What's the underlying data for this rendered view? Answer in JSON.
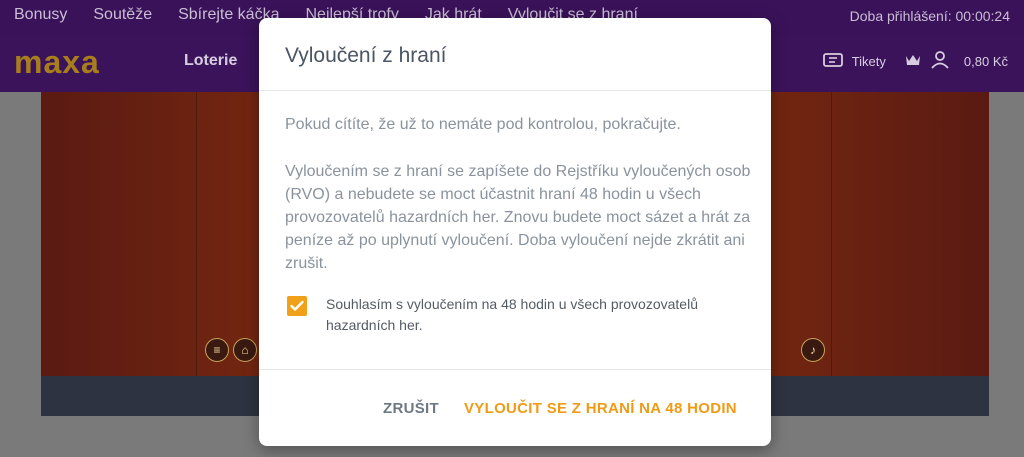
{
  "top_nav": {
    "items": [
      "Bonusy",
      "Soutěže",
      "Sbírejte káčka",
      "Nejlepší trofy",
      "Jak hrát",
      "Vyloučit se z hraní"
    ],
    "login_time": "Doba přihlášení: 00:00:24"
  },
  "header": {
    "logo": "maxa",
    "menu": [
      "Loterie"
    ],
    "tickets_label": "Tikety",
    "balance": "0,80 Kč"
  },
  "modal": {
    "title": "Vyloučení z hraní",
    "paragraph1": "Pokud cítíte, že už to nemáte pod kontrolou, pokračujte.",
    "paragraph2": "Vyloučením se z hraní se zapíšete do Rejstříku vyloučených osob (RVO) a nebudete se moct účastnit hraní 48 hodin u všech provozovatelů hazardních her. Znovu budete moct sázet a hrát za peníze až po uplynutí vyloučení. Doba vyloučení nejde zkrátit ani zrušit.",
    "consent": {
      "checked": true,
      "label": "Souhlasím s vyloučením na 48 hodin u všech provozovatelů hazardních her."
    },
    "buttons": {
      "cancel": "ZRUŠIT",
      "confirm": "VYLOUČIT SE Z HRANÍ NA 48 HODIN"
    }
  },
  "colors": {
    "brand_purple": "#3b135b",
    "accent_orange": "#ef9b16",
    "logo_gold": "#a77d1d"
  }
}
